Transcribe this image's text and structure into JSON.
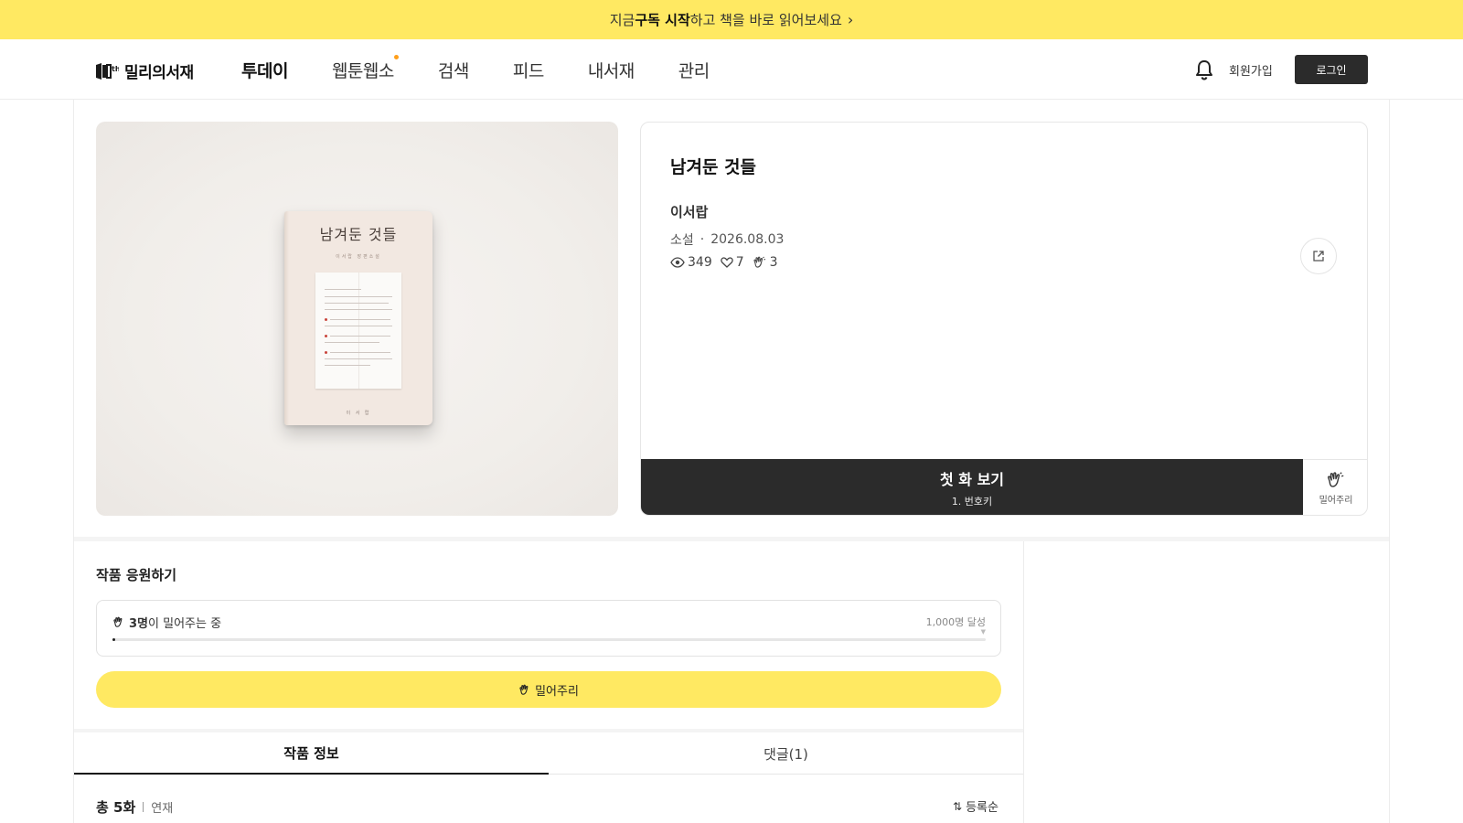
{
  "banner": {
    "prefix": "지금 ",
    "emphasis": "구독 시작",
    "suffix": "하고 책을 바로 읽어보세요",
    "chevron_icon": "chevron-right-icon"
  },
  "header": {
    "logo_text": "밀리의서재",
    "nav": [
      {
        "label": "투데이",
        "active": true
      },
      {
        "label": "웹툰웹소",
        "active": false,
        "has_dot": true
      },
      {
        "label": "검색",
        "active": false
      },
      {
        "label": "피드",
        "active": false
      },
      {
        "label": "내서재",
        "active": false
      },
      {
        "label": "관리",
        "active": false
      }
    ],
    "bell_icon": "bell-icon",
    "signup_label": "회원가입",
    "login_label": "로그인",
    "dot_color": "#ff9f1a"
  },
  "cover": {
    "book_title": "남겨둔 것들",
    "book_subtitle": "이서랍 장편소설",
    "book_author": "이 서 랍"
  },
  "work": {
    "title": "남겨둔 것들",
    "author": "이서랍",
    "genre": "소설",
    "date": "2026.08.03",
    "views": "349",
    "likes": "7",
    "cheers": "3",
    "share_icon": "share-icon"
  },
  "cta": {
    "main_label": "첫 화 보기",
    "sub_label": "1. 번호키",
    "cheer_side_label": "밀어주리"
  },
  "support": {
    "title": "작품 응원하기",
    "count_strong": "3명",
    "count_suffix": "이 밀어주는 중",
    "goal_label": "1,000명 달성",
    "progress_fraction": 0.003,
    "button_label": "밀어주리"
  },
  "tabs": [
    {
      "label": "작품 정보",
      "active": true
    },
    {
      "label": "댓글(1)",
      "active": false
    }
  ],
  "episodes": {
    "total_label": "총 5화",
    "status_label": "연재",
    "sort_icon": "sort-icon",
    "sort_label": "등록순"
  },
  "colors": {
    "accent_yellow": "#ffe962",
    "dark": "#2b2b2b"
  }
}
